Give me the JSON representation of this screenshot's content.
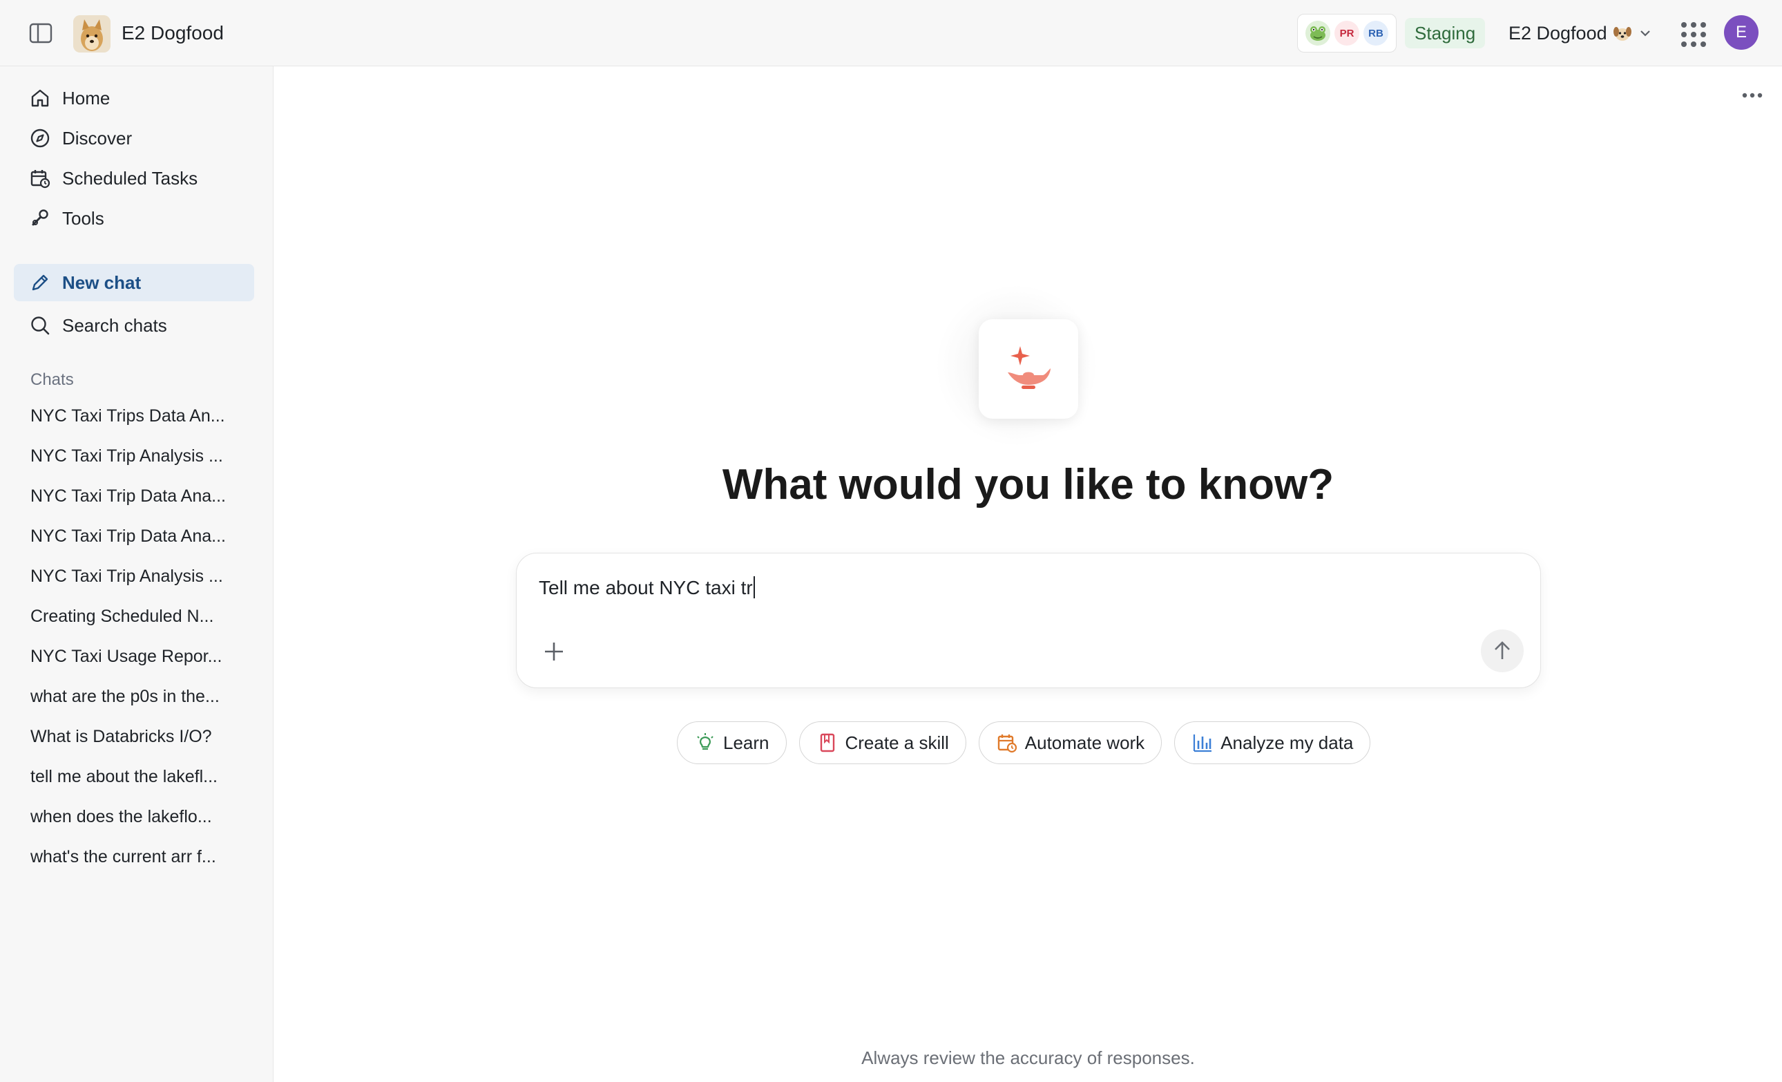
{
  "header": {
    "workspace_title": "E2 Dogfood",
    "collaborators": [
      {
        "initials": "",
        "icon": "frog-avatar"
      },
      {
        "initials": "PR"
      },
      {
        "initials": "RB"
      }
    ],
    "environment_badge": "Staging",
    "workspace_switcher_label": "E2 Dogfood",
    "user_initial": "E"
  },
  "sidebar": {
    "nav": [
      {
        "label": "Home",
        "icon": "home-icon"
      },
      {
        "label": "Discover",
        "icon": "compass-icon"
      },
      {
        "label": "Scheduled Tasks",
        "icon": "calendar-clock-icon"
      },
      {
        "label": "Tools",
        "icon": "tools-icon"
      }
    ],
    "new_chat": "New chat",
    "search_chats": "Search chats",
    "chats_heading": "Chats",
    "chats": [
      "NYC Taxi Trips Data An...",
      "NYC Taxi Trip Analysis ...",
      "NYC Taxi Trip Data Ana...",
      "NYC Taxi Trip Data Ana...",
      "NYC Taxi Trip Analysis ...",
      "Creating Scheduled N...",
      "NYC Taxi Usage Repor...",
      "what are the p0s in the...",
      "What is Databricks I/O?",
      "tell me about the lakefl...",
      "when does the lakeflo...",
      "what's the current arr f..."
    ]
  },
  "main": {
    "title": "What would you like to know?",
    "composer_value": "Tell me about NYC taxi tr",
    "suggestions": [
      {
        "label": "Learn",
        "icon": "lightbulb-icon",
        "color": "#3b9a57"
      },
      {
        "label": "Create a skill",
        "icon": "bookmark-icon",
        "color": "#d9475a"
      },
      {
        "label": "Automate work",
        "icon": "calendar-clock-icon",
        "color": "#e07a2b"
      },
      {
        "label": "Analyze my data",
        "icon": "bar-chart-icon",
        "color": "#3c7fd6"
      }
    ],
    "disclaimer": "Always review the accuracy of responses."
  },
  "colors": {
    "accent": "#1c4f86",
    "active_bg": "#e4ecf5",
    "brand_icon": "#e8604c",
    "user_avatar": "#7b4fbf"
  }
}
